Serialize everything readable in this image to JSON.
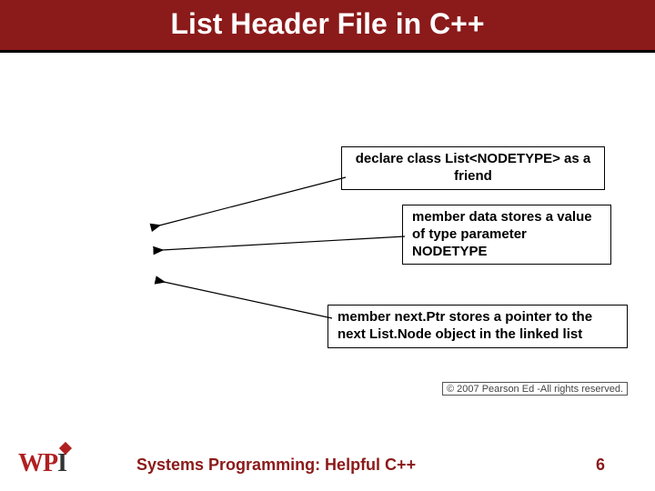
{
  "title": "List Header File in C++",
  "callouts": {
    "c1": "declare class List<NODETYPE> as a friend",
    "c2": "member data stores a value of type parameter NODETYPE",
    "c3": "member next.Ptr stores a pointer to the next List.Node object in the linked list"
  },
  "copyright": "© 2007 Pearson Ed -All rights reserved.",
  "footer": {
    "text": "Systems Programming: Helpful C++",
    "page": "6"
  },
  "logo": {
    "w": "W",
    "p": "P",
    "i": "I"
  }
}
